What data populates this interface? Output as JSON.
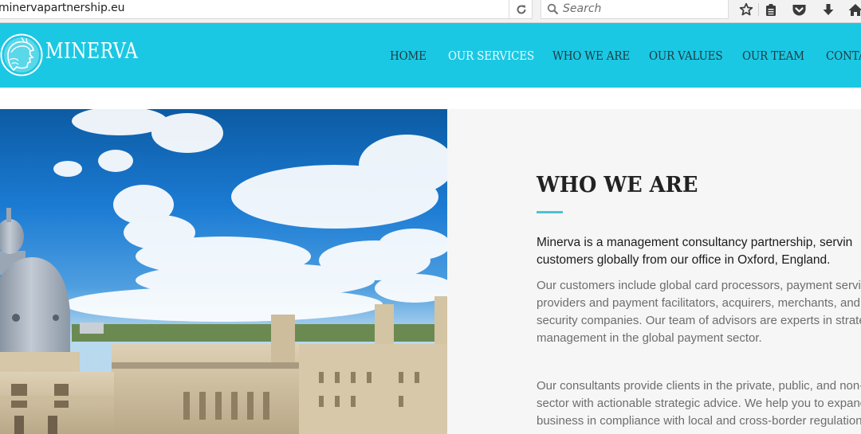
{
  "browser": {
    "url": "minervapartnership.eu",
    "search_placeholder": "Search",
    "icons": [
      "reload-icon",
      "search-icon",
      "bookmark-star-icon",
      "reading-list-icon",
      "pocket-icon",
      "download-icon",
      "home-icon"
    ]
  },
  "header": {
    "logo_text": "MINERVA",
    "brand_color": "#1bc8e3",
    "nav": [
      {
        "label": "HOME",
        "active": false
      },
      {
        "label": "OUR SERVICES",
        "active": true
      },
      {
        "label": "WHO WE ARE",
        "active": false
      },
      {
        "label": "OUR VALUES",
        "active": false
      },
      {
        "label": "OUR TEAM",
        "active": false
      },
      {
        "label": "CONTA",
        "active": false
      }
    ]
  },
  "hero": {
    "image_description": "Aerial view of Oxford: Radcliffe Camera dome and All Souls College under a blue sky with white clouds"
  },
  "section": {
    "title": "WHO WE ARE",
    "accent_color": "#4bc3d3",
    "lead_lines": [
      "Minerva is a management consultancy partnership, servin",
      "customers globally from our office in Oxford, England."
    ],
    "paragraph1_lines": [
      "Our customers include global card processors, payment service",
      "providers and payment facilitators, acquirers, merchants, and p",
      "security companies. Our team of advisors are experts in strateg",
      "management in the global payment sector."
    ],
    "paragraph2_lines": [
      "Our consultants provide clients in the private, public, and non-p",
      "sector with actionable strategic advice. We help you to expand",
      "business in compliance with local and cross-border regulations"
    ]
  }
}
